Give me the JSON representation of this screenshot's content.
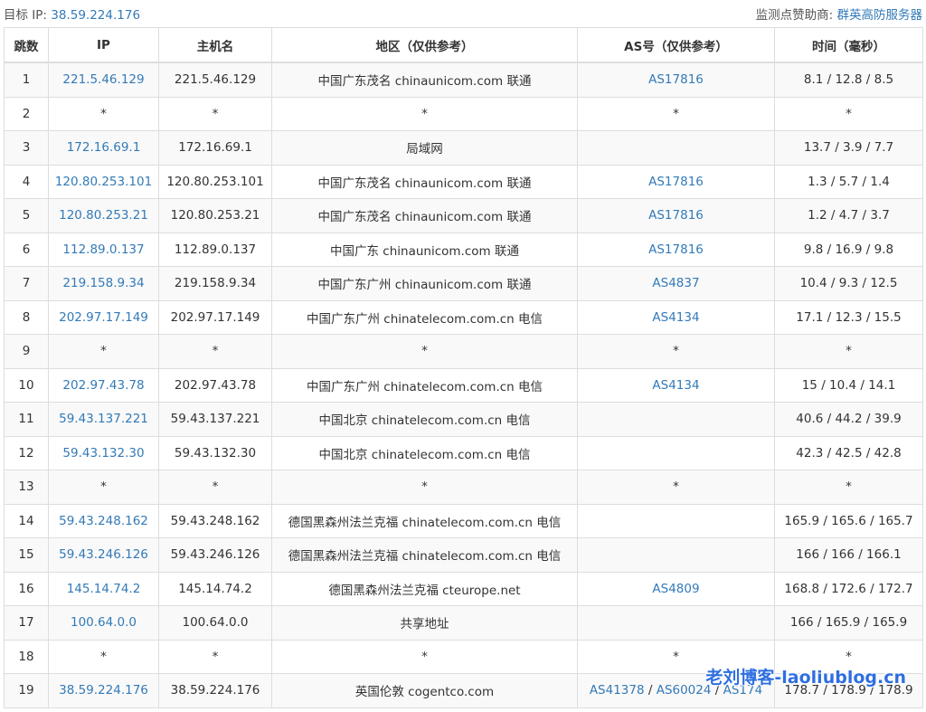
{
  "header": {
    "target_label": "目标 IP:",
    "target_ip": "38.59.224.176",
    "sponsor_label": "监测点赞助商:",
    "sponsor_name": "群英高防服务器"
  },
  "table": {
    "columns": [
      "跳数",
      "IP",
      "主机名",
      "地区（仅供参考）",
      "AS号（仅供参考）",
      "时间（毫秒）"
    ],
    "rows": [
      {
        "hop": "1",
        "ip": "221.5.46.129",
        "host": "221.5.46.129",
        "region": "中国广东茂名 chinaunicom.com 联通",
        "asn": [
          "AS17816"
        ],
        "time": "8.1 / 12.8 / 8.5"
      },
      {
        "hop": "2",
        "ip": "*",
        "host": "*",
        "region": "*",
        "asn": [
          "*"
        ],
        "time": "*"
      },
      {
        "hop": "3",
        "ip": "172.16.69.1",
        "host": "172.16.69.1",
        "region": "局域网",
        "asn": [],
        "time": "13.7 / 3.9 / 7.7"
      },
      {
        "hop": "4",
        "ip": "120.80.253.101",
        "host": "120.80.253.101",
        "region": "中国广东茂名 chinaunicom.com 联通",
        "asn": [
          "AS17816"
        ],
        "time": "1.3 / 5.7 / 1.4"
      },
      {
        "hop": "5",
        "ip": "120.80.253.21",
        "host": "120.80.253.21",
        "region": "中国广东茂名 chinaunicom.com 联通",
        "asn": [
          "AS17816"
        ],
        "time": "1.2 / 4.7 / 3.7"
      },
      {
        "hop": "6",
        "ip": "112.89.0.137",
        "host": "112.89.0.137",
        "region": "中国广东 chinaunicom.com 联通",
        "asn": [
          "AS17816"
        ],
        "time": "9.8 / 16.9 / 9.8"
      },
      {
        "hop": "7",
        "ip": "219.158.9.34",
        "host": "219.158.9.34",
        "region": "中国广东广州 chinaunicom.com 联通",
        "asn": [
          "AS4837"
        ],
        "time": "10.4 / 9.3 / 12.5"
      },
      {
        "hop": "8",
        "ip": "202.97.17.149",
        "host": "202.97.17.149",
        "region": "中国广东广州 chinatelecom.com.cn 电信",
        "asn": [
          "AS4134"
        ],
        "time": "17.1 / 12.3 / 15.5"
      },
      {
        "hop": "9",
        "ip": "*",
        "host": "*",
        "region": "*",
        "asn": [
          "*"
        ],
        "time": "*"
      },
      {
        "hop": "10",
        "ip": "202.97.43.78",
        "host": "202.97.43.78",
        "region": "中国广东广州 chinatelecom.com.cn 电信",
        "asn": [
          "AS4134"
        ],
        "time": "15 / 10.4 / 14.1"
      },
      {
        "hop": "11",
        "ip": "59.43.137.221",
        "host": "59.43.137.221",
        "region": "中国北京 chinatelecom.com.cn 电信",
        "asn": [],
        "time": "40.6 / 44.2 / 39.9"
      },
      {
        "hop": "12",
        "ip": "59.43.132.30",
        "host": "59.43.132.30",
        "region": "中国北京 chinatelecom.com.cn 电信",
        "asn": [],
        "time": "42.3 / 42.5 / 42.8"
      },
      {
        "hop": "13",
        "ip": "*",
        "host": "*",
        "region": "*",
        "asn": [
          "*"
        ],
        "time": "*"
      },
      {
        "hop": "14",
        "ip": "59.43.248.162",
        "host": "59.43.248.162",
        "region": "德国黑森州法兰克福 chinatelecom.com.cn 电信",
        "asn": [],
        "time": "165.9 / 165.6 / 165.7"
      },
      {
        "hop": "15",
        "ip": "59.43.246.126",
        "host": "59.43.246.126",
        "region": "德国黑森州法兰克福 chinatelecom.com.cn 电信",
        "asn": [],
        "time": "166 / 166 / 166.1"
      },
      {
        "hop": "16",
        "ip": "145.14.74.2",
        "host": "145.14.74.2",
        "region": "德国黑森州法兰克福 cteurope.net",
        "asn": [
          "AS4809"
        ],
        "time": "168.8 / 172.6 / 172.7"
      },
      {
        "hop": "17",
        "ip": "100.64.0.0",
        "host": "100.64.0.0",
        "region": "共享地址",
        "asn": [],
        "time": "166 / 165.9 / 165.9"
      },
      {
        "hop": "18",
        "ip": "*",
        "host": "*",
        "region": "*",
        "asn": [
          "*"
        ],
        "time": "*"
      },
      {
        "hop": "19",
        "ip": "38.59.224.176",
        "host": "38.59.224.176",
        "region": "英国伦敦 cogentco.com",
        "asn": [
          "AS41378",
          "AS60024",
          "AS174"
        ],
        "time": "178.7 / 178.9 / 178.9"
      }
    ]
  },
  "watermark": "老刘博客-laoliublog.cn",
  "colors": {
    "link": "#337ab7",
    "border": "#dddddd",
    "stripe": "#f9f9f9",
    "watermark": "#2f6fe0"
  }
}
